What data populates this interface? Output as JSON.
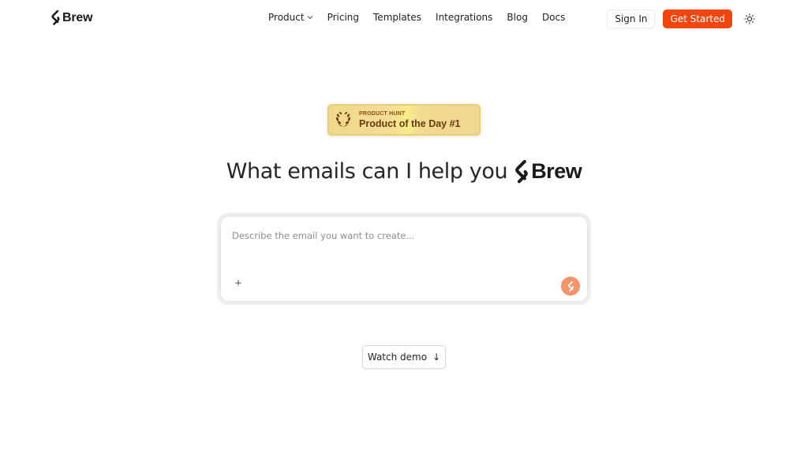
{
  "brand": {
    "name": "Brew",
    "logo_icon": "brew-s-icon",
    "accent": "#f2460e"
  },
  "nav": {
    "items": [
      {
        "label": "Product",
        "has_dropdown": true
      },
      {
        "label": "Pricing"
      },
      {
        "label": "Templates"
      },
      {
        "label": "Integrations"
      },
      {
        "label": "Blog"
      },
      {
        "label": "Docs"
      }
    ],
    "sign_in": "Sign In",
    "get_started": "Get Started",
    "theme_icon": "sun-icon"
  },
  "badge": {
    "kicker": "PRODUCT HUNT",
    "title": "Product of the Day #1",
    "icon": "laurel-wreath-icon"
  },
  "hero": {
    "title": "What emails can I help you",
    "brand": "Brew"
  },
  "prompt": {
    "placeholder": "Describe the email you want to create...",
    "value": "",
    "attach_label": "+",
    "send_color": "#f6936a"
  },
  "demo": {
    "label": "Watch demo",
    "arrow": "↓"
  }
}
